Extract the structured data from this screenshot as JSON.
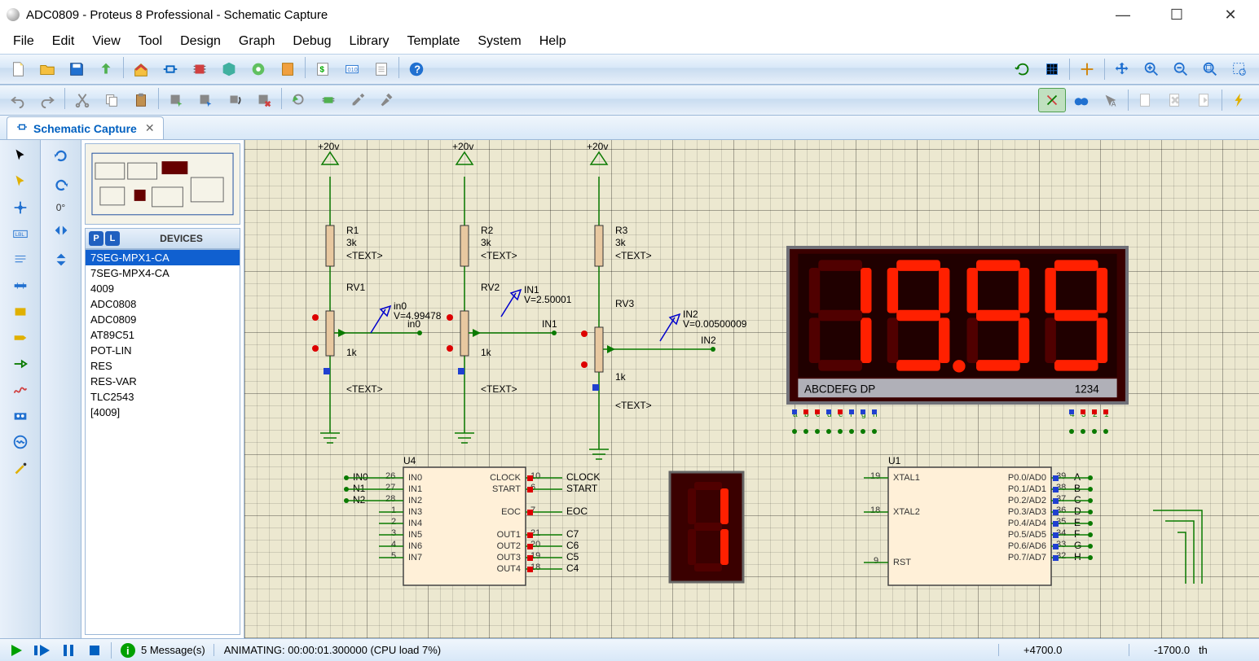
{
  "window": {
    "title": "ADC0809 - Proteus 8 Professional - Schematic Capture"
  },
  "menu": [
    "File",
    "Edit",
    "View",
    "Tool",
    "Design",
    "Graph",
    "Debug",
    "Library",
    "Template",
    "System",
    "Help"
  ],
  "tab": {
    "label": "Schematic Capture"
  },
  "rotate": {
    "degrees": "0°"
  },
  "devices": {
    "header": "DEVICES",
    "items": [
      "7SEG-MPX1-CA",
      "7SEG-MPX4-CA",
      "4009",
      "ADC0808",
      "ADC0809",
      "AT89C51",
      "POT-LIN",
      "RES",
      "RES-VAR",
      "TLC2543",
      "[4009]"
    ],
    "selected": 0
  },
  "canvas": {
    "supply": "+20v",
    "resistors": [
      {
        "ref": "R1",
        "val": "3k",
        "text": "<TEXT>"
      },
      {
        "ref": "R2",
        "val": "3k",
        "text": "<TEXT>"
      },
      {
        "ref": "R3",
        "val": "3k",
        "text": "<TEXT>"
      }
    ],
    "pots": [
      {
        "ref": "RV1",
        "val": "1k",
        "text": "<TEXT>",
        "net": "in0",
        "probe_name": "in0",
        "probe_v": "V=4.99478"
      },
      {
        "ref": "RV2",
        "val": "1k",
        "text": "<TEXT>",
        "net": "IN1",
        "probe_name": "IN1",
        "probe_v": "V=2.50001"
      },
      {
        "ref": "RV3",
        "val": "1k",
        "text": "<TEXT>",
        "net": "IN2",
        "probe_name": "IN2",
        "probe_v": "V=0.00500009"
      }
    ],
    "u4": {
      "ref": "U4",
      "left_nets": [
        "IN0",
        "N1",
        "N2"
      ],
      "left_pins_outer": [
        "26",
        "27",
        "28",
        "1",
        "2",
        "3",
        "4",
        "5"
      ],
      "left_pins_inner": [
        "IN0",
        "IN1",
        "IN2",
        "IN3",
        "IN4",
        "IN5",
        "IN6",
        "IN7"
      ],
      "right_top_inner": [
        "CLOCK",
        "START",
        "",
        "EOC",
        "",
        "OUT1",
        "OUT2",
        "OUT3",
        "OUT4"
      ],
      "right_top_outer": [
        "10",
        "6",
        "",
        "7",
        "",
        "21",
        "20",
        "19",
        "18"
      ],
      "right_nets": [
        "CLOCK",
        "START",
        "",
        "EOC",
        "",
        "C7",
        "C6",
        "C5",
        "C4"
      ]
    },
    "u1": {
      "ref": "U1",
      "left_pins_outer": [
        "19",
        "",
        "18",
        "",
        "",
        "9"
      ],
      "left_pins_inner": [
        "XTAL1",
        "",
        "XTAL2",
        "",
        "",
        "RST"
      ],
      "right_inner": [
        "P0.0/AD0",
        "P0.1/AD1",
        "P0.2/AD2",
        "P0.3/AD3",
        "P0.4/AD4",
        "P0.5/AD5",
        "P0.6/AD6",
        "P0.7/AD7"
      ],
      "right_outer": [
        "39",
        "38",
        "37",
        "36",
        "35",
        "34",
        "33",
        "32"
      ],
      "right_nets": [
        "A",
        "B",
        "C",
        "D",
        "E",
        "F",
        "G",
        "H"
      ]
    },
    "display4": {
      "digits": "19.99",
      "pins_label": "ABCDEFG DP",
      "sel_label": "1234",
      "seg_letters": [
        "a",
        "b",
        "c",
        "d",
        "e",
        "f",
        "g",
        "h"
      ],
      "sel_nums": [
        "4",
        "3",
        "2",
        "1"
      ]
    },
    "display1": {
      "digit": "1"
    }
  },
  "status": {
    "messages": "5 Message(s)",
    "anim": "ANIMATING: 00:00:01.300000 (CPU load 7%)",
    "x": "+4700.0",
    "y": "-1700.0",
    "unit": "th"
  }
}
